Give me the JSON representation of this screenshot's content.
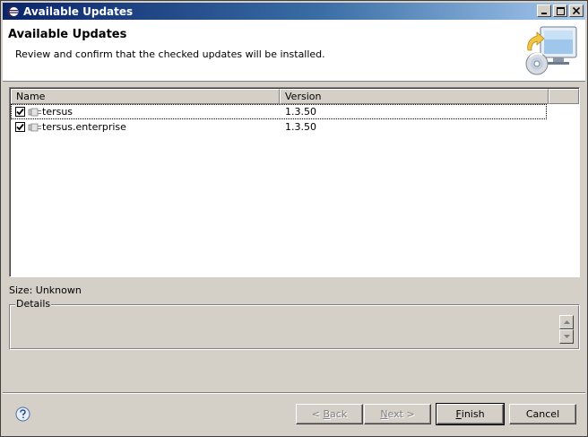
{
  "window": {
    "title": "Available Updates"
  },
  "header": {
    "title": "Available Updates",
    "description": "Review and confirm that the checked updates will be installed."
  },
  "table": {
    "columns": [
      "Name",
      "Version"
    ],
    "rows": [
      {
        "name": "tersus",
        "version": "1.3.50",
        "checked": true,
        "selected": true
      },
      {
        "name": "tersus.enterprise",
        "version": "1.3.50",
        "checked": true,
        "selected": false
      }
    ]
  },
  "size_label": "Size: Unknown",
  "details": {
    "legend": "Details"
  },
  "buttons": {
    "back_prefix": "< ",
    "back_mnemonic": "B",
    "back_rest": "ack",
    "next_mnemonic": "N",
    "next_rest": "ext >",
    "finish_mnemonic": "F",
    "finish_rest": "inish",
    "cancel": "Cancel"
  },
  "colors": {
    "title_bar_start": "#0a246a",
    "title_bar_end": "#a6caf0",
    "dialog_background": "#d4d0c8"
  },
  "icons": {
    "title": "eclipse-icon",
    "header": "update-monitor-icon",
    "feature": "plug-in-icon",
    "help": "help-icon"
  }
}
